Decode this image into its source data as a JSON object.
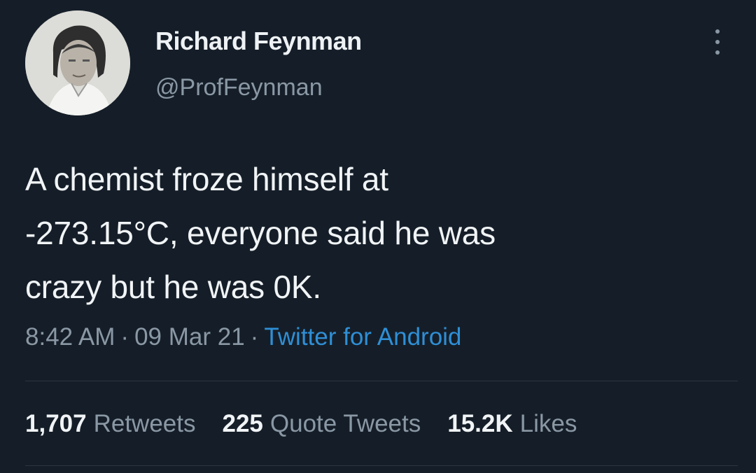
{
  "tweet": {
    "author": {
      "name": "Richard Feynman",
      "handle": "@ProfFeynman"
    },
    "text_lines": [
      "A chemist froze himself at",
      "-273.15°C, everyone said he was",
      "crazy but he was 0K."
    ],
    "time": "8:42 AM",
    "date": "09 Mar 21",
    "separator": "·",
    "source": "Twitter for Android",
    "stats": [
      {
        "value": "1,707",
        "label": "Retweets"
      },
      {
        "value": "225",
        "label": "Quote Tweets"
      },
      {
        "value": "15.2K",
        "label": "Likes"
      }
    ]
  },
  "icons": {
    "more": "more-vertical-icon",
    "avatar": "profile-photo"
  },
  "colors": {
    "background": "#151e28",
    "primary_text": "#f1f4f6",
    "secondary_text": "#8a98a5",
    "link": "#2f8fd6",
    "divider": "#2c3640"
  }
}
